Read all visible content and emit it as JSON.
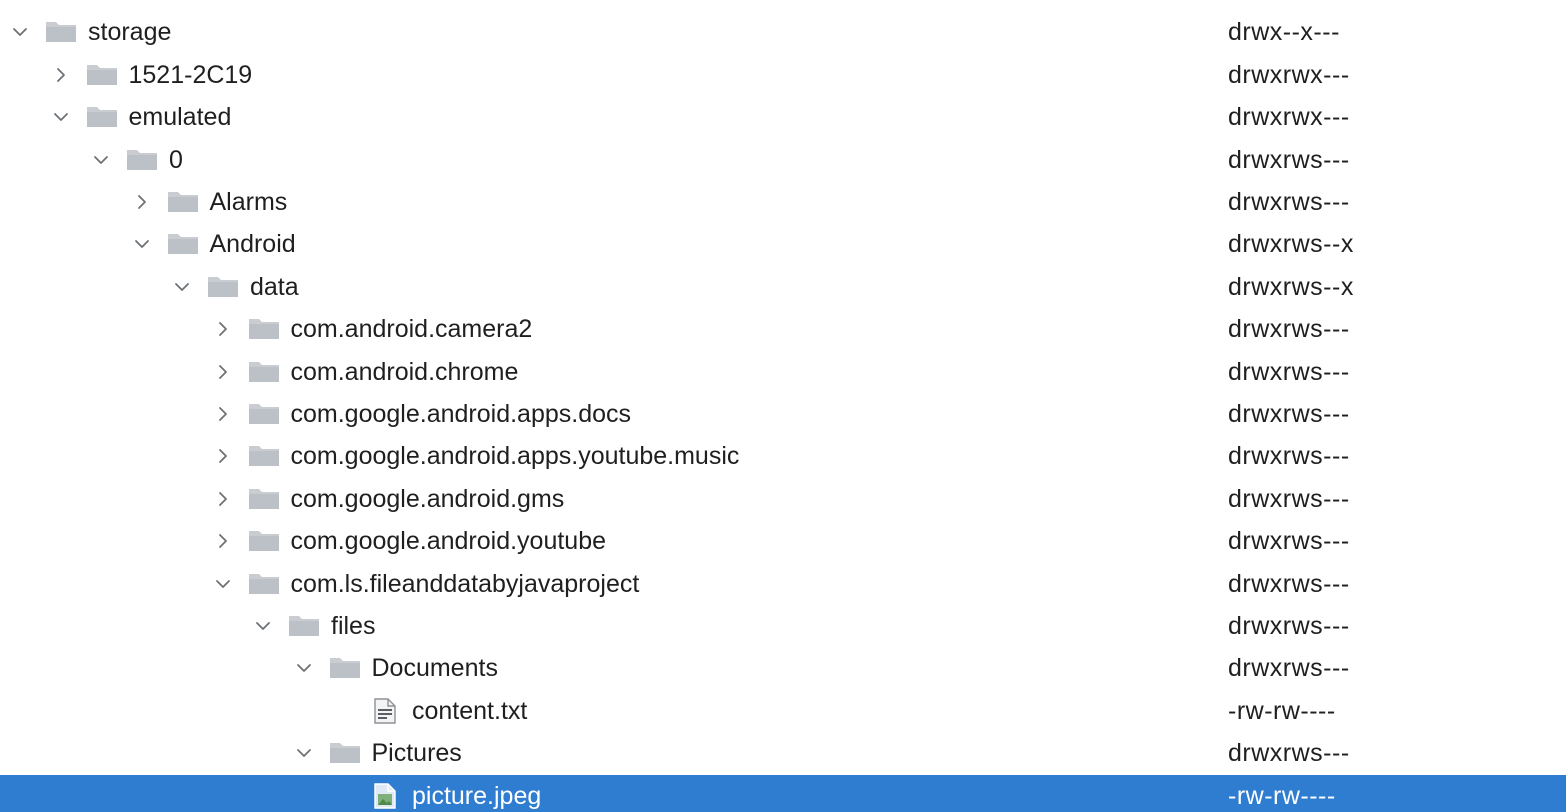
{
  "tree": {
    "rows": [
      {
        "name": "",
        "perms": "",
        "depth": 0,
        "expand": "none",
        "kind": "folder",
        "partial": true
      },
      {
        "name": "storage",
        "perms": "drwx--x---",
        "depth": 0,
        "expand": "open",
        "kind": "folder"
      },
      {
        "name": "1521-2C19",
        "perms": "drwxrwx---",
        "depth": 1,
        "expand": "closed",
        "kind": "folder"
      },
      {
        "name": "emulated",
        "perms": "drwxrwx---",
        "depth": 1,
        "expand": "open",
        "kind": "folder"
      },
      {
        "name": "0",
        "perms": "drwxrws---",
        "depth": 2,
        "expand": "open",
        "kind": "folder"
      },
      {
        "name": "Alarms",
        "perms": "drwxrws---",
        "depth": 3,
        "expand": "closed",
        "kind": "folder"
      },
      {
        "name": "Android",
        "perms": "drwxrws--x",
        "depth": 3,
        "expand": "open",
        "kind": "folder"
      },
      {
        "name": "data",
        "perms": "drwxrws--x",
        "depth": 4,
        "expand": "open",
        "kind": "folder"
      },
      {
        "name": "com.android.camera2",
        "perms": "drwxrws---",
        "depth": 5,
        "expand": "closed",
        "kind": "folder"
      },
      {
        "name": "com.android.chrome",
        "perms": "drwxrws---",
        "depth": 5,
        "expand": "closed",
        "kind": "folder"
      },
      {
        "name": "com.google.android.apps.docs",
        "perms": "drwxrws---",
        "depth": 5,
        "expand": "closed",
        "kind": "folder"
      },
      {
        "name": "com.google.android.apps.youtube.music",
        "perms": "drwxrws---",
        "depth": 5,
        "expand": "closed",
        "kind": "folder"
      },
      {
        "name": "com.google.android.gms",
        "perms": "drwxrws---",
        "depth": 5,
        "expand": "closed",
        "kind": "folder"
      },
      {
        "name": "com.google.android.youtube",
        "perms": "drwxrws---",
        "depth": 5,
        "expand": "closed",
        "kind": "folder"
      },
      {
        "name": "com.ls.fileanddatabyjavaproject",
        "perms": "drwxrws---",
        "depth": 5,
        "expand": "open",
        "kind": "folder"
      },
      {
        "name": "files",
        "perms": "drwxrws---",
        "depth": 6,
        "expand": "open",
        "kind": "folder"
      },
      {
        "name": "Documents",
        "perms": "drwxrws---",
        "depth": 7,
        "expand": "open",
        "kind": "folder"
      },
      {
        "name": "content.txt",
        "perms": "-rw-rw----",
        "depth": 8,
        "expand": "none",
        "kind": "text-file"
      },
      {
        "name": "Pictures",
        "perms": "drwxrws---",
        "depth": 7,
        "expand": "open",
        "kind": "folder"
      },
      {
        "name": "picture.jpeg",
        "perms": "-rw-rw----",
        "depth": 8,
        "expand": "none",
        "kind": "image-file",
        "selected": true
      }
    ]
  },
  "colors": {
    "selection": "#2f7dd1",
    "folder": "#c9cdd2",
    "text": "#1f1f1f"
  }
}
